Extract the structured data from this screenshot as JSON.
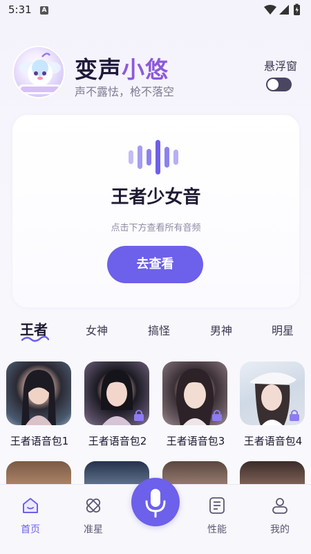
{
  "status_bar": {
    "time": "5:31",
    "notification_letter": "A"
  },
  "header": {
    "title_part1": "变声",
    "title_part2": "小悠",
    "subtitle": "声不露怯，枪不落空",
    "float_window_label": "悬浮窗",
    "float_window_enabled": false
  },
  "feature_card": {
    "title": "王者少女音",
    "hint": "点击下方查看所有音频",
    "button_label": "去查看"
  },
  "tabs": [
    {
      "label": "王者",
      "active": true
    },
    {
      "label": "女神",
      "active": false
    },
    {
      "label": "搞怪",
      "active": false
    },
    {
      "label": "男神",
      "active": false
    },
    {
      "label": "明星",
      "active": false
    }
  ],
  "voice_packs": [
    {
      "name": "王者语音包1",
      "locked": false
    },
    {
      "name": "王者语音包2",
      "locked": true
    },
    {
      "name": "王者语音包3",
      "locked": true
    },
    {
      "name": "王者语音包4",
      "locked": true
    }
  ],
  "bottom_nav": [
    {
      "label": "首页",
      "icon": "home-icon",
      "active": true
    },
    {
      "label": "准星",
      "icon": "crosshair-icon",
      "active": false
    },
    {
      "label": "性能",
      "icon": "performance-icon",
      "active": false
    },
    {
      "label": "我的",
      "icon": "profile-icon",
      "active": false
    }
  ],
  "colors": {
    "accent": "#6d60ea",
    "title_accent": "#8c5ad9",
    "toggle_off": "#4a4662"
  }
}
